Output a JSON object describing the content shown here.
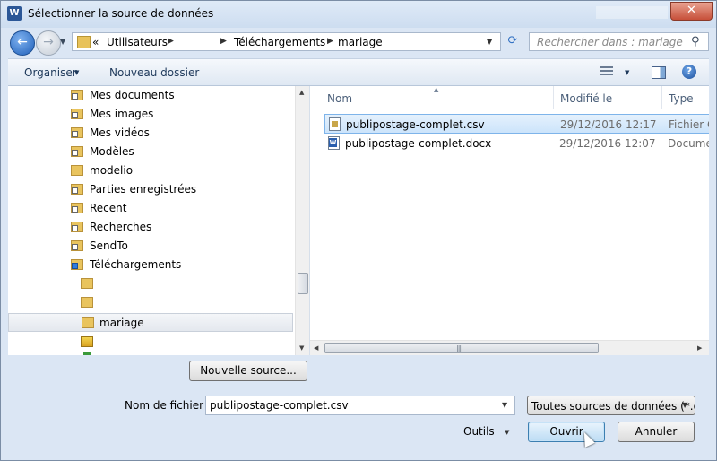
{
  "window": {
    "title": "Sélectionner la source de données",
    "app_icon": "W"
  },
  "nav": {
    "back_icon": "back-arrow-icon",
    "forward_icon": "forward-arrow-icon",
    "address": {
      "prefix": "«",
      "segments": [
        "Utilisateurs",
        "",
        "Téléchargements",
        "mariage"
      ]
    },
    "search_placeholder": "Rechercher dans : mariage"
  },
  "toolbar": {
    "organize": "Organiser",
    "new_folder": "Nouveau dossier"
  },
  "tree": [
    {
      "label": "Mes documents",
      "icon": "folder-shortcut-icon"
    },
    {
      "label": "Mes images",
      "icon": "folder-shortcut-icon"
    },
    {
      "label": "Mes vidéos",
      "icon": "folder-shortcut-icon"
    },
    {
      "label": "Modèles",
      "icon": "folder-shortcut-icon"
    },
    {
      "label": "modelio",
      "icon": "folder-icon"
    },
    {
      "label": "Parties enregistrées",
      "icon": "folder-shortcut-icon"
    },
    {
      "label": "Recent",
      "icon": "folder-shortcut-icon"
    },
    {
      "label": "Recherches",
      "icon": "search-folder-icon"
    },
    {
      "label": "SendTo",
      "icon": "folder-shortcut-icon"
    },
    {
      "label": "Téléchargements",
      "icon": "downloads-folder-icon"
    },
    {
      "label": "",
      "icon": "folder-icon"
    },
    {
      "label": "",
      "icon": "folder-icon"
    },
    {
      "label": "mariage",
      "icon": "folder-icon"
    }
  ],
  "columns": {
    "name": "Nom",
    "modified": "Modifié le",
    "type": "Type"
  },
  "files": [
    {
      "name": "publipostage-complet.csv",
      "modified": "29/12/2016 12:17",
      "type": "Fichier C",
      "icon": "csv-file-icon"
    },
    {
      "name": "publipostage-complet.docx",
      "modified": "29/12/2016 12:07",
      "type": "Documen",
      "icon": "word-document-icon"
    }
  ],
  "buttons": {
    "new_source": "Nouvelle source...",
    "open": "Ouvrir",
    "cancel": "Annuler",
    "tools": "Outils"
  },
  "filename": {
    "label": "Nom de fichier :",
    "value": "publipostage-complet.csv"
  },
  "filter": {
    "value": "Toutes sources de données (*.o"
  },
  "colors": {
    "window_bg": "#dbe6f4",
    "selection": "#cce4fb",
    "primary_button": "#bcdcf4"
  }
}
